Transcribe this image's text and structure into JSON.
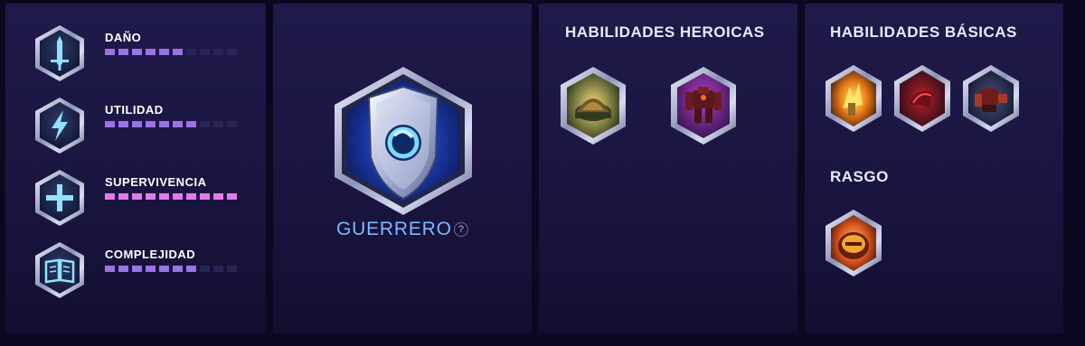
{
  "stats": [
    {
      "label": "DAÑO",
      "icon": "sword-icon",
      "value": 6,
      "max": 10,
      "fill_color": "#9a73e6"
    },
    {
      "label": "UTILIDAD",
      "icon": "lightning-icon",
      "value": 7,
      "max": 10,
      "fill_color": "#9a73e6"
    },
    {
      "label": "SUPERVIVENCIA",
      "icon": "plus-icon",
      "value": 10,
      "max": 10,
      "fill_color": "#e27be8"
    },
    {
      "label": "COMPLEJIDAD",
      "icon": "book-icon",
      "value": 7,
      "max": 10,
      "fill_color": "#9a73e6"
    }
  ],
  "role": {
    "name": "GUERRERO",
    "help": "?"
  },
  "heroic": {
    "title": "HABILIDADES HEROICAS",
    "abilities": [
      {
        "icon": "fortress-dome-icon"
      },
      {
        "icon": "robot-mech-icon"
      }
    ]
  },
  "basic": {
    "title": "HABILIDADES BÁSICAS",
    "abilities": [
      {
        "icon": "explosion-icon"
      },
      {
        "icon": "claw-strike-icon"
      },
      {
        "icon": "dash-mech-icon"
      }
    ]
  },
  "trait": {
    "title": "RASGO",
    "icon": "armor-shell-icon"
  },
  "colors": {
    "bar_empty": "#2a2454",
    "bar_fill": "#9a73e6",
    "bar_fill_max": "#e27be8",
    "role_text": "#7fb6ff"
  }
}
